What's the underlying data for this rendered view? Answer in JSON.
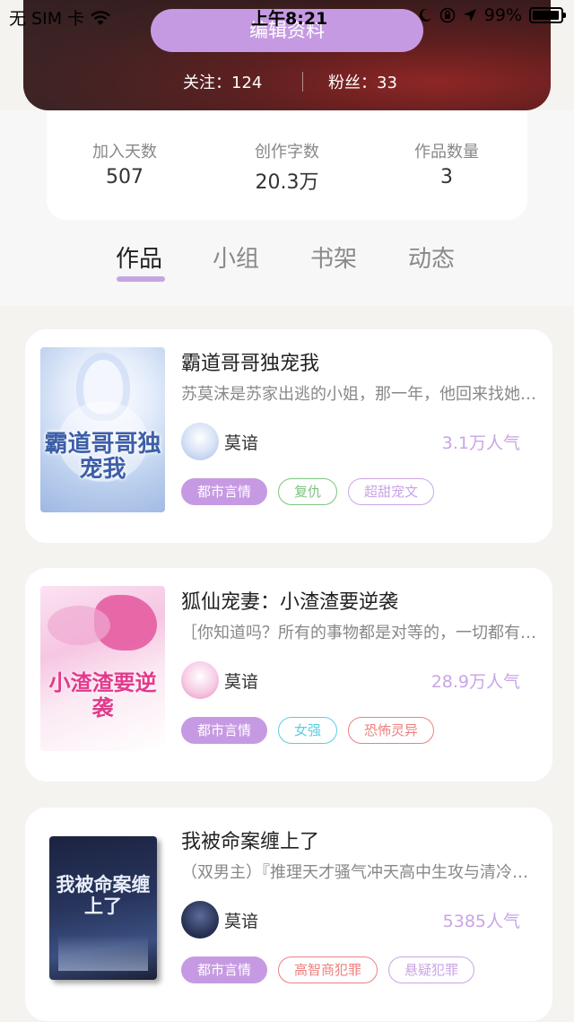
{
  "status_bar": {
    "carrier": "无 SIM 卡",
    "time": "上午8:21",
    "battery": "99%"
  },
  "header": {
    "edit_button": "编辑资料",
    "following": "关注：124",
    "fans": "粉丝：33"
  },
  "stats": [
    {
      "label": "加入天数",
      "value": "507"
    },
    {
      "label": "创作字数",
      "value": "20.3万"
    },
    {
      "label": "作品数量",
      "value": "3"
    }
  ],
  "tabs": [
    {
      "label": "作品",
      "active": true
    },
    {
      "label": "小组",
      "active": false
    },
    {
      "label": "书架",
      "active": false
    },
    {
      "label": "动态",
      "active": false
    }
  ],
  "books": [
    {
      "title": "霸道哥哥独宠我",
      "description": "苏莫沫是苏家出逃的小姐，那一年，他回来找她……",
      "author": "莫谙",
      "popularity": "3.1万人气",
      "cover_text": "霸道哥哥独宠我",
      "tags": [
        {
          "label": "都市言情",
          "color": "#c69ae2",
          "solid": true
        },
        {
          "label": "复仇",
          "color": "#7cc47f",
          "solid": false
        },
        {
          "label": "超甜宠文",
          "color": "#c9a5e6",
          "solid": false
        }
      ]
    },
    {
      "title": "狐仙宠妻：小渣渣要逆袭",
      "description": "［你知道吗？所有的事物都是对等的，一切都有代价］",
      "author": "莫谙",
      "popularity": "28.9万人气",
      "cover_text": "小渣渣要逆袭",
      "tags": [
        {
          "label": "都市言情",
          "color": "#c69ae2",
          "solid": true
        },
        {
          "label": "女强",
          "color": "#5ccde0",
          "solid": false
        },
        {
          "label": "恐怖灵异",
          "color": "#ee7f7f",
          "solid": false
        }
      ]
    },
    {
      "title": "我被命案缠上了",
      "description": "（双男主）『推理天才骚气冲天高中生攻与清冷学霸受』",
      "author": "莫谙",
      "popularity": "5385人气",
      "cover_text": "我被命案缠上了",
      "tags": [
        {
          "label": "都市言情",
          "color": "#c69ae2",
          "solid": true
        },
        {
          "label": "高智商犯罪",
          "color": "#ee7f7f",
          "solid": false
        },
        {
          "label": "悬疑犯罪",
          "color": "#c9a5e6",
          "solid": false
        }
      ]
    }
  ]
}
